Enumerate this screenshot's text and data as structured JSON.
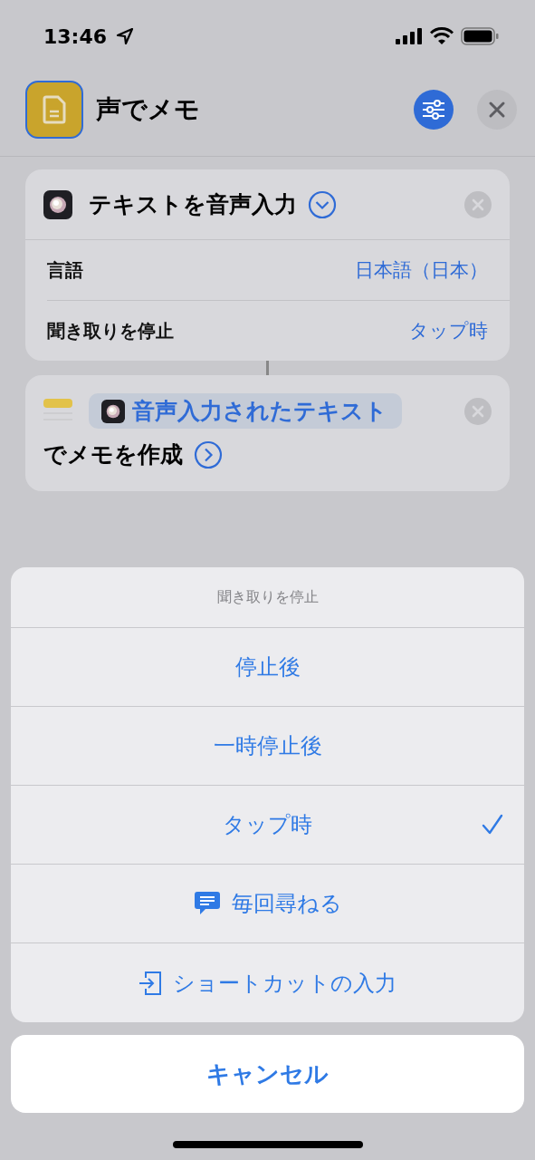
{
  "status_bar": {
    "time": "13:46"
  },
  "header": {
    "title": "声でメモ"
  },
  "actions": [
    {
      "kind": "dictate",
      "title": "テキストを音声入力",
      "params": [
        {
          "label": "言語",
          "value": "日本語（日本）"
        },
        {
          "label": "聞き取りを停止",
          "value": "タップ時"
        }
      ]
    },
    {
      "kind": "note",
      "variable": "音声入力されたテキスト",
      "suffix": "でメモを作成"
    }
  ],
  "sheet": {
    "title": "聞き取りを停止",
    "options": [
      {
        "label": "停止後",
        "kind": "plain",
        "selected": false
      },
      {
        "label": "一時停止後",
        "kind": "plain",
        "selected": false
      },
      {
        "label": "タップ時",
        "kind": "plain",
        "selected": true
      },
      {
        "label": "毎回尋ねる",
        "kind": "ask",
        "selected": false
      },
      {
        "label": "ショートカットの入力",
        "kind": "input",
        "selected": false
      }
    ],
    "cancel": "キャンセル"
  }
}
